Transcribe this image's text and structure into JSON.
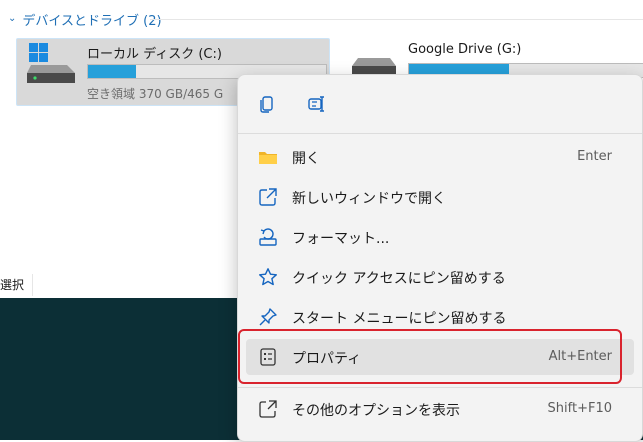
{
  "section": {
    "label": "デバイスとドライブ (2)"
  },
  "drives": [
    {
      "name": "ローカル ディスク (C:)",
      "free": "空き領域 370 GB/465 G",
      "usage": 0.2
    },
    {
      "name": "Google Drive (G:)",
      "usage": 0.42
    }
  ],
  "status": {
    "select_label": "選択"
  },
  "menu": {
    "items": [
      {
        "label": "開く",
        "shortcut": "Enter",
        "icon": "folder-icon"
      },
      {
        "label": "新しいウィンドウで開く",
        "shortcut": "",
        "icon": "open-new-window-icon"
      },
      {
        "label": "フォーマット...",
        "shortcut": "",
        "icon": "format-drive-icon"
      },
      {
        "label": "クイック アクセスにピン留めする",
        "shortcut": "",
        "icon": "star-icon"
      },
      {
        "label": "スタート メニューにピン留めする",
        "shortcut": "",
        "icon": "pin-icon"
      },
      {
        "label": "プロパティ",
        "shortcut": "Alt+Enter",
        "icon": "properties-icon"
      },
      {
        "label": "その他のオプションを表示",
        "shortcut": "Shift+F10",
        "icon": "more-options-icon"
      }
    ]
  },
  "colors": {
    "accent": "#26a0da",
    "highlight": "#d9232d",
    "desktop": "#0c2f36"
  }
}
